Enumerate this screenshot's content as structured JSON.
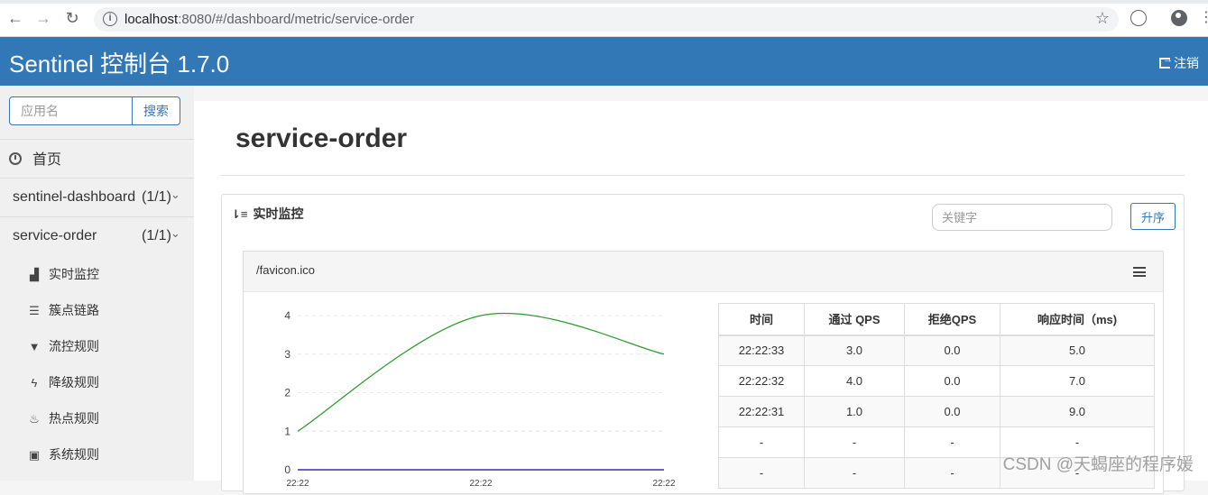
{
  "browser": {
    "url_host": "localhost",
    "url_rest": ":8080/#/dashboard/metric/service-order"
  },
  "header": {
    "brand": "Sentinel 控制台 1.7.0",
    "logout_label": "注销"
  },
  "sidebar": {
    "search_placeholder": "应用名",
    "search_button": "搜索",
    "home_label": "首页",
    "apps": [
      {
        "name": "sentinel-dashboard",
        "count": "(1/1)"
      },
      {
        "name": "service-order",
        "count": "(1/1)"
      }
    ],
    "menu": [
      {
        "label": "实时监控",
        "icon": "bar-chart-icon"
      },
      {
        "label": "簇点链路",
        "icon": "list-icon"
      },
      {
        "label": "流控规则",
        "icon": "filter-icon"
      },
      {
        "label": "降级规则",
        "icon": "flash-icon"
      },
      {
        "label": "热点规则",
        "icon": "fire-icon"
      },
      {
        "label": "系统规则",
        "icon": "lock-icon"
      }
    ]
  },
  "main": {
    "title": "service-order",
    "panel_title": "实时监控",
    "keyword_placeholder": "关键字",
    "sort_button": "升序",
    "resource": "/favicon.ico",
    "table": {
      "headers": [
        "时间",
        "通过 QPS",
        "拒绝QPS",
        "响应时间（ms)"
      ],
      "rows": [
        [
          "22:22:33",
          "3.0",
          "0.0",
          "5.0"
        ],
        [
          "22:22:32",
          "4.0",
          "0.0",
          "7.0"
        ],
        [
          "22:22:31",
          "1.0",
          "0.0",
          "9.0"
        ],
        [
          "-",
          "-",
          "-",
          "-"
        ],
        [
          "-",
          "-",
          "-",
          "-"
        ]
      ]
    }
  },
  "chart_data": {
    "type": "line",
    "x": [
      "22:22",
      "22:22",
      "22:22"
    ],
    "series": [
      {
        "values": [
          1,
          4,
          3
        ],
        "color": "#2f9b2f"
      },
      {
        "values": [
          0,
          0,
          0
        ],
        "color": "#6c5fc7"
      }
    ],
    "yticks": [
      "0",
      "1",
      "2",
      "3",
      "4"
    ],
    "ylim": [
      0,
      4
    ],
    "grid": true
  },
  "watermark": "CSDN @天蝎座的程序媛"
}
